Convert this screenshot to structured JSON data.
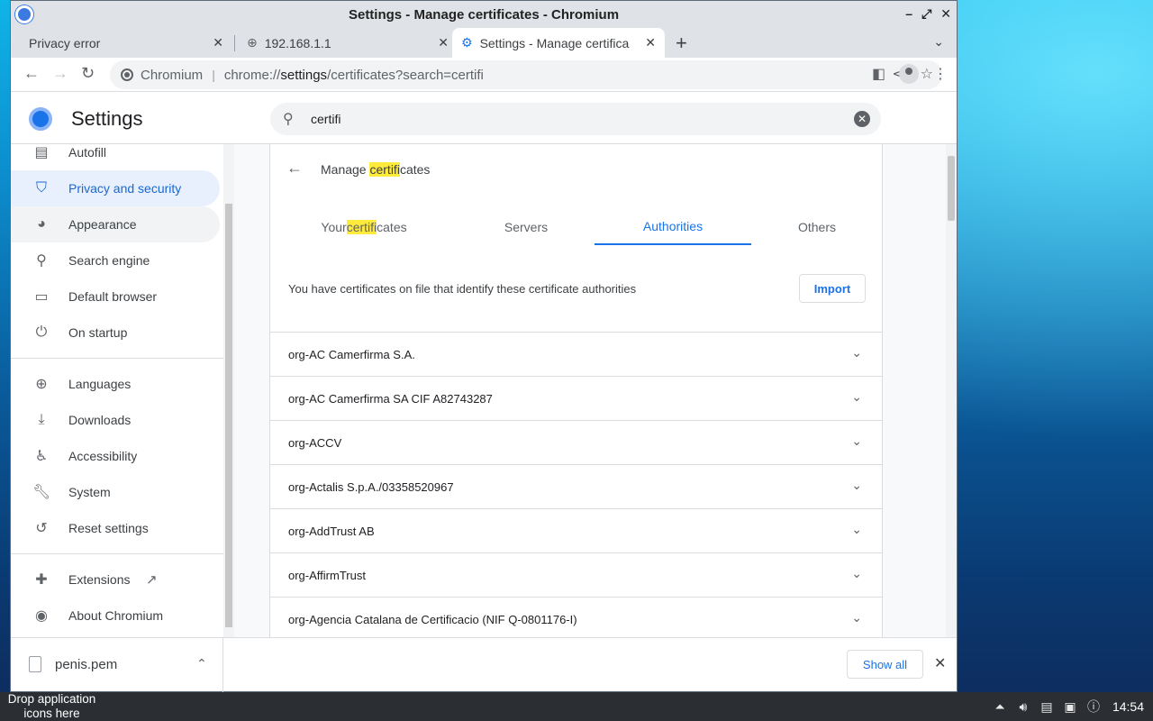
{
  "window": {
    "title": "Settings - Manage certificates - Chromium"
  },
  "tabs": [
    {
      "label": "Privacy error"
    },
    {
      "label": "192.168.1.1"
    },
    {
      "label": "Settings - Manage certifica"
    }
  ],
  "omnibox": {
    "label": "Chromium",
    "scheme": "chrome://",
    "host": "settings",
    "path": "/certificates?search=certifi"
  },
  "settings": {
    "title": "Settings",
    "search_value": "certifi"
  },
  "sidebar": {
    "items": [
      {
        "label": "Autofill",
        "icon": "clipboard-icon"
      },
      {
        "label": "Privacy and security",
        "icon": "shield-icon"
      },
      {
        "label": "Appearance",
        "icon": "palette-icon"
      },
      {
        "label": "Search engine",
        "icon": "search-icon"
      },
      {
        "label": "Default browser",
        "icon": "browser-icon"
      },
      {
        "label": "On startup",
        "icon": "power-icon"
      },
      {
        "label": "Languages",
        "icon": "globe-icon"
      },
      {
        "label": "Downloads",
        "icon": "download-icon"
      },
      {
        "label": "Accessibility",
        "icon": "accessibility-icon"
      },
      {
        "label": "System",
        "icon": "wrench-icon"
      },
      {
        "label": "Reset settings",
        "icon": "reset-icon"
      },
      {
        "label": "Extensions",
        "icon": "puzzle-icon"
      },
      {
        "label": "About Chromium",
        "icon": "chromium-icon"
      }
    ]
  },
  "manage": {
    "title_pre": "Manage ",
    "title_mark": "certifi",
    "title_post": "cates",
    "tabs": {
      "your_pre": "Your ",
      "your_mark": "certifi",
      "your_post": "cates",
      "servers": "Servers",
      "authorities": "Authorities",
      "others": "Others"
    },
    "description": "You have certificates on file that identify these certificate authorities",
    "import_label": "Import",
    "certs": [
      "org-AC Camerfirma S.A.",
      "org-AC Camerfirma SA CIF A82743287",
      "org-ACCV",
      "org-Actalis S.p.A./03358520967",
      "org-AddTrust AB",
      "org-AffirmTrust",
      "org-Agencia Catalana de Certificacio (NIF Q-0801176-I)"
    ]
  },
  "downloads": {
    "file": "penis.pem",
    "show_all": "Show all"
  },
  "taskbar": {
    "drop_text": "Drop application icons here",
    "clock": "14:54"
  }
}
